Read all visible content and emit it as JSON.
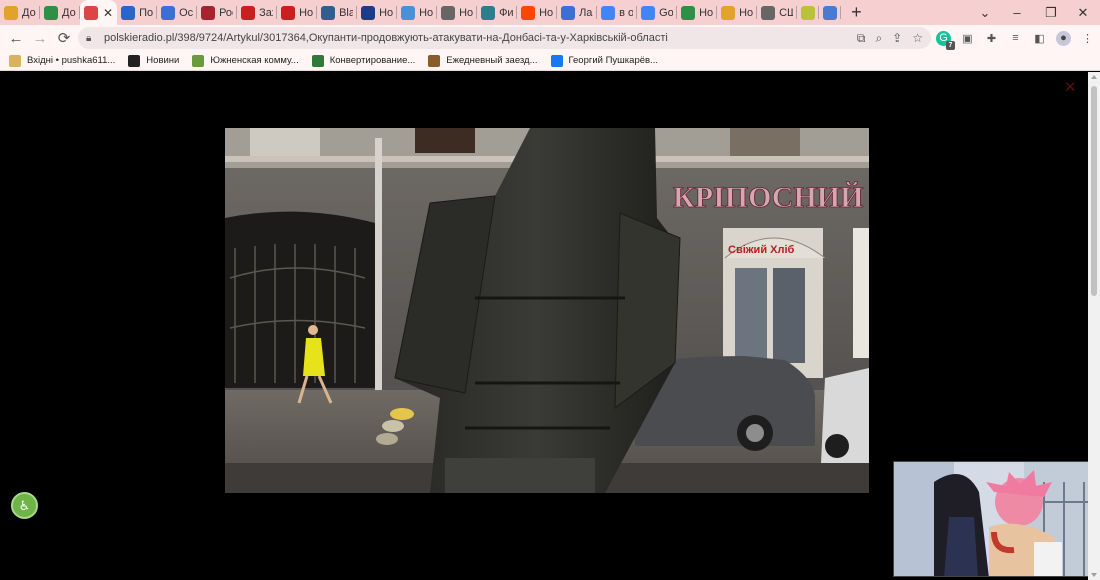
{
  "tabs": [
    {
      "title": "Доз",
      "icon": "sun-icon",
      "color": "#e2a22b"
    },
    {
      "title": "Доз",
      "icon": "green-globe-icon",
      "color": "#2f8f46"
    },
    {
      "title": "",
      "icon": "pattern-icon",
      "color": "#d44",
      "active": true
    },
    {
      "title": "Пол",
      "icon": "ukraine-flag-icon",
      "color": "#2a66c9"
    },
    {
      "title": "Ост",
      "icon": "u-letter-icon",
      "color": "#3c6fd3"
    },
    {
      "title": "Рос",
      "icon": "ub-icon",
      "color": "#a3232e"
    },
    {
      "title": "Зах",
      "icon": "3f-icon",
      "color": "#c81f1f"
    },
    {
      "title": "Нов",
      "icon": "24-icon",
      "color": "#c81f1f"
    },
    {
      "title": "Blac",
      "icon": "blackbook-icon",
      "color": "#2f5e8f"
    },
    {
      "title": "Нов",
      "icon": "o-circle-icon",
      "color": "#1c3c8a"
    },
    {
      "title": "Нов",
      "icon": "bars-icon",
      "color": "#4a90d9"
    },
    {
      "title": "Нов",
      "icon": "globe-icon",
      "color": "#666"
    },
    {
      "title": "Фин",
      "icon": "fin-icon",
      "color": "#2e7d8c"
    },
    {
      "title": "Нов",
      "icon": "orange-dot-icon",
      "color": "#ff4500"
    },
    {
      "title": "Лав",
      "icon": "d-circle-icon",
      "color": "#3b6fd4"
    },
    {
      "title": "в ос",
      "icon": "google-icon",
      "color": "#4285f4"
    },
    {
      "title": "Goo",
      "icon": "translate-icon",
      "color": "#4285f4"
    },
    {
      "title": "Нов",
      "icon": "green-globe-icon",
      "color": "#2f8f46"
    },
    {
      "title": "Нов",
      "icon": "sun-icon",
      "color": "#e2a22b"
    },
    {
      "title": "США",
      "icon": "globe-icon",
      "color": "#666"
    },
    {
      "title": "",
      "icon": "sun-icon",
      "color": "#b8c23a"
    },
    {
      "title": "",
      "icon": "media-icon",
      "color": "#4a7bd0"
    }
  ],
  "window": {
    "minimize": "–",
    "maximize": "❐",
    "close": "✕",
    "menu": "⌄",
    "new_tab": "+"
  },
  "address_bar": {
    "url": "polskieradio.pl/398/9724/Artykul/3017364,Окупанти-продовжують-атакувати-на-Донбасі-та-у-Харківській-області"
  },
  "extensions": {
    "badge": "7"
  },
  "bookmarks": [
    {
      "label": "Вхідні • pushka611...",
      "icon": "gmail-icon",
      "color": "#d9b25f"
    },
    {
      "label": "Новини",
      "icon": "news-24-icon",
      "color": "#222"
    },
    {
      "label": "Южненская комму...",
      "icon": "leaf-icon",
      "color": "#6a9b3a"
    },
    {
      "label": "Конвертирование...",
      "icon": "converter-icon",
      "color": "#2f7a3a"
    },
    {
      "label": "Ежедневный заезд...",
      "icon": "game-icon",
      "color": "#8a5a2b"
    },
    {
      "label": "Георгий Пушкарёв...",
      "icon": "facebook-icon",
      "color": "#1877f2"
    }
  ],
  "photo": {
    "shop_sign": "КРІПОСНИЙ",
    "bakery_sign": "Свіжий Хліб"
  }
}
